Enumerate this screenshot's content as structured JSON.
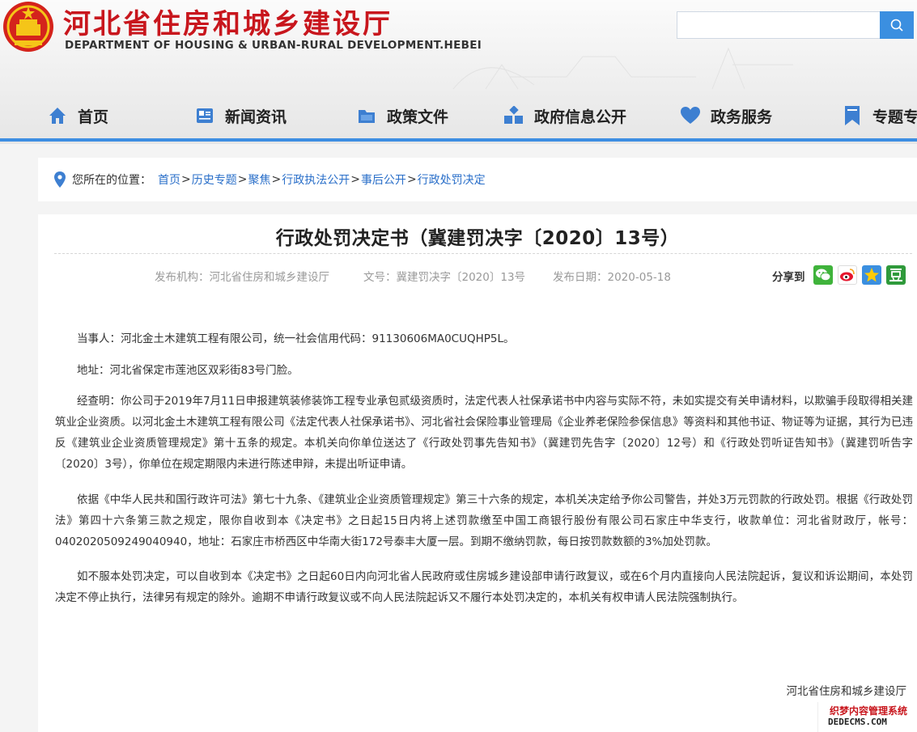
{
  "header": {
    "site_name_cn": "河北省住房和城乡建设厅",
    "site_name_en": "DEPARTMENT OF HOUSING & URBAN-RURAL DEVELOPMENT.HEBEI",
    "search_placeholder": ""
  },
  "nav": {
    "items": [
      {
        "label": "首页",
        "icon": "home-icon"
      },
      {
        "label": "新闻资讯",
        "icon": "news-icon"
      },
      {
        "label": "政策文件",
        "icon": "folder-icon"
      },
      {
        "label": "政府信息公开",
        "icon": "blocks-icon"
      },
      {
        "label": "政务服务",
        "icon": "heart-icon"
      },
      {
        "label": "专题专",
        "icon": "bookmark-icon"
      }
    ]
  },
  "breadcrumb": {
    "prefix": "您所在的位置：",
    "items": [
      "首页",
      "历史专题",
      "聚焦",
      "行政执法公开",
      "事后公开",
      "行政处罚决定"
    ],
    "separator": ">"
  },
  "article": {
    "title": "行政处罚决定书（冀建罚决字〔2020〕13号）",
    "publisher": "发布机构：河北省住房和城乡建设厅",
    "doc_no": "文号：冀建罚决字〔2020〕13号",
    "date": "发布日期：2020-05-18",
    "share_label": "分享到",
    "share_icons": [
      "wechat-icon",
      "weibo-icon",
      "qzone-icon",
      "douban-icon"
    ],
    "paragraphs": [
      "当事人：河北金土木建筑工程有限公司，统一社会信用代码：91130606MA0CUQHP5L。",
      "地址：河北省保定市莲池区双彩街83号门脸。",
      "经查明：你公司于2019年7月11日申报建筑装修装饰工程专业承包贰级资质时，法定代表人社保承诺书中内容与实际不符，未如实提交有关申请材料，以欺骗手段取得相关建筑业企业资质。以河北金土木建筑工程有限公司《法定代表人社保承诺书》、河北省社会保险事业管理局《企业养老保险参保信息》等资料和其他书证、物证等为证据，其行为已违反《建筑业企业资质管理规定》第十五条的规定。本机关向你单位送达了《行政处罚事先告知书》（冀建罚先告字〔2020〕12号）和《行政处罚听证告知书》（冀建罚听告字〔2020〕3号），你单位在规定期限内未进行陈述申辩，未提出听证申请。",
      "依据《中华人民共和国行政许可法》第七十九条、《建筑业企业资质管理规定》第三十六条的规定，本机关决定给予你公司警告，并处3万元罚款的行政处罚。根据《行政处罚法》第四十六条第三款之规定，限你自收到本《决定书》之日起15日内将上述罚款缴至中国工商银行股份有限公司石家庄中华支行，收款单位：河北省财政厅，帐号：0402020509249040940，地址：石家庄市桥西区中华南大街172号泰丰大厦一层。到期不缴纳罚款，每日按罚款数额的3%加处罚款。",
      "如不服本处罚决定，可以自收到本《决定书》之日起60日内向河北省人民政府或住房城乡建设部申请行政复议，或在6个月内直接向人民法院起诉，复议和诉讼期间，本处罚决定不停止执行，法律另有规定的除外。逾期不申请行政复议或不向人民法院起诉又不履行本处罚决定的，本机关有权申请人民法院强制执行。"
    ],
    "signer": "河北省住房和城乡建设厅"
  },
  "watermark": {
    "line1": "织梦内容管理系统",
    "line2": "DEDECMS.COM"
  },
  "colors": {
    "brand_red": "#c8161d",
    "nav_blue": "#3d8ee2",
    "link_blue": "#2a6fc9"
  }
}
